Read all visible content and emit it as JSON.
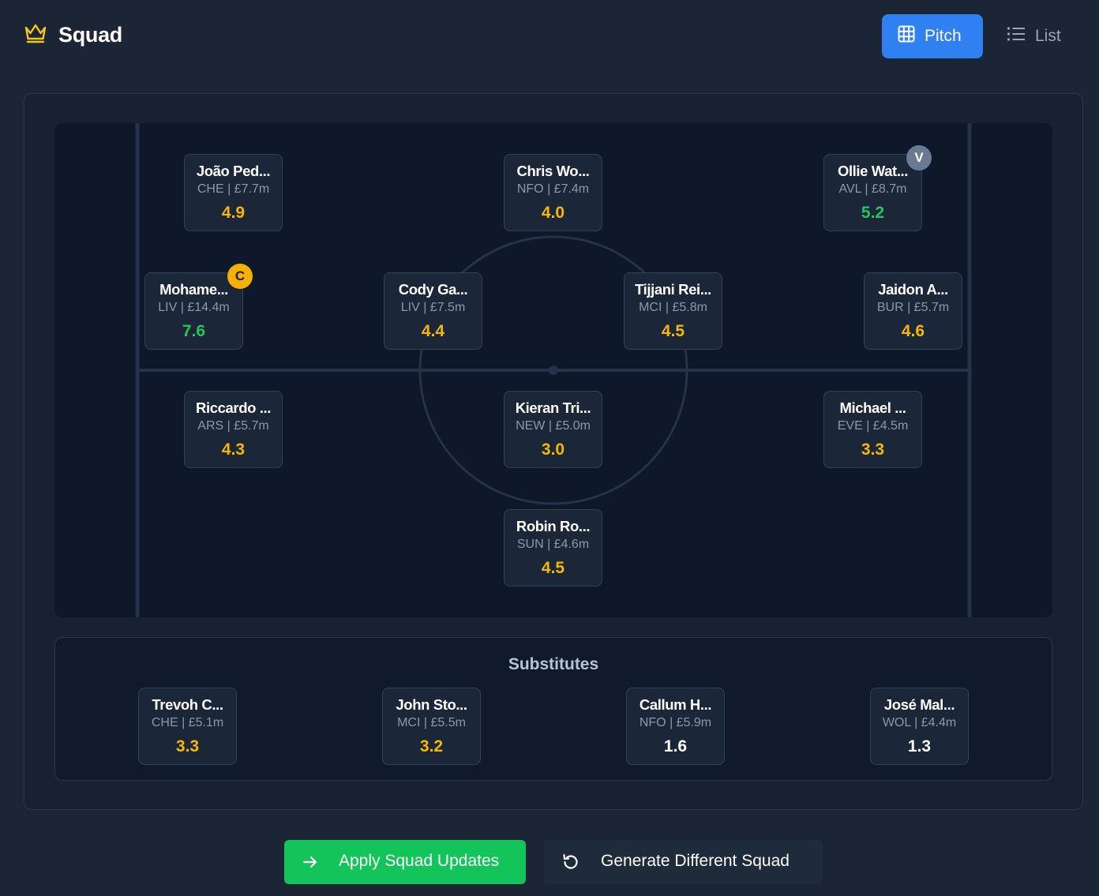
{
  "header": {
    "title": "Squad",
    "pitch_label": "Pitch",
    "list_label": "List",
    "crown_color": "#f5c518",
    "active_color": "#2f80f0"
  },
  "pitch_players": [
    {
      "name": "João Ped...",
      "meta": "CHE | £7.7m",
      "points": "4.9",
      "tier": "mid"
    },
    {
      "name": "Chris Wo...",
      "meta": "NFO | £7.4m",
      "points": "4.0",
      "tier": "mid"
    },
    {
      "name": "Ollie Wat...",
      "meta": "AVL | £8.7m",
      "points": "5.2",
      "tier": "high",
      "badge": "V"
    },
    {
      "name": "Mohame...",
      "meta": "LIV | £14.4m",
      "points": "7.6",
      "tier": "high",
      "badge": "C"
    },
    {
      "name": "Cody Ga...",
      "meta": "LIV | £7.5m",
      "points": "4.4",
      "tier": "mid"
    },
    {
      "name": "Tijjani Rei...",
      "meta": "MCI | £5.8m",
      "points": "4.5",
      "tier": "mid"
    },
    {
      "name": "Jaidon A...",
      "meta": "BUR | £5.7m",
      "points": "4.6",
      "tier": "mid"
    },
    {
      "name": "Riccardo ...",
      "meta": "ARS | £5.7m",
      "points": "4.3",
      "tier": "mid"
    },
    {
      "name": "Kieran Tri...",
      "meta": "NEW | £5.0m",
      "points": "3.0",
      "tier": "mid"
    },
    {
      "name": "Michael ...",
      "meta": "EVE | £4.5m",
      "points": "3.3",
      "tier": "mid"
    },
    {
      "name": "Robin Ro...",
      "meta": "SUN | £4.6m",
      "points": "4.5",
      "tier": "mid"
    }
  ],
  "substitutes": {
    "title": "Substitutes",
    "players": [
      {
        "name": "Trevoh C...",
        "meta": "CHE | £5.1m",
        "points": "3.3",
        "tier": "mid"
      },
      {
        "name": "John Sto...",
        "meta": "MCI | £5.5m",
        "points": "3.2",
        "tier": "mid"
      },
      {
        "name": "Callum H...",
        "meta": "NFO | £5.9m",
        "points": "1.6",
        "tier": "low"
      },
      {
        "name": "José Mal...",
        "meta": "WOL | £4.4m",
        "points": "1.3",
        "tier": "low"
      }
    ]
  },
  "actions": {
    "apply_label": "Apply Squad Updates",
    "regenerate_label": "Generate Different Squad",
    "apply_color": "#12c45a"
  },
  "colors": {
    "points_high": "#22c55e",
    "points_mid": "#f5b800",
    "points_low": "#ffffff",
    "captain_badge": "#f5b000",
    "vice_badge": "#6b7a92"
  }
}
